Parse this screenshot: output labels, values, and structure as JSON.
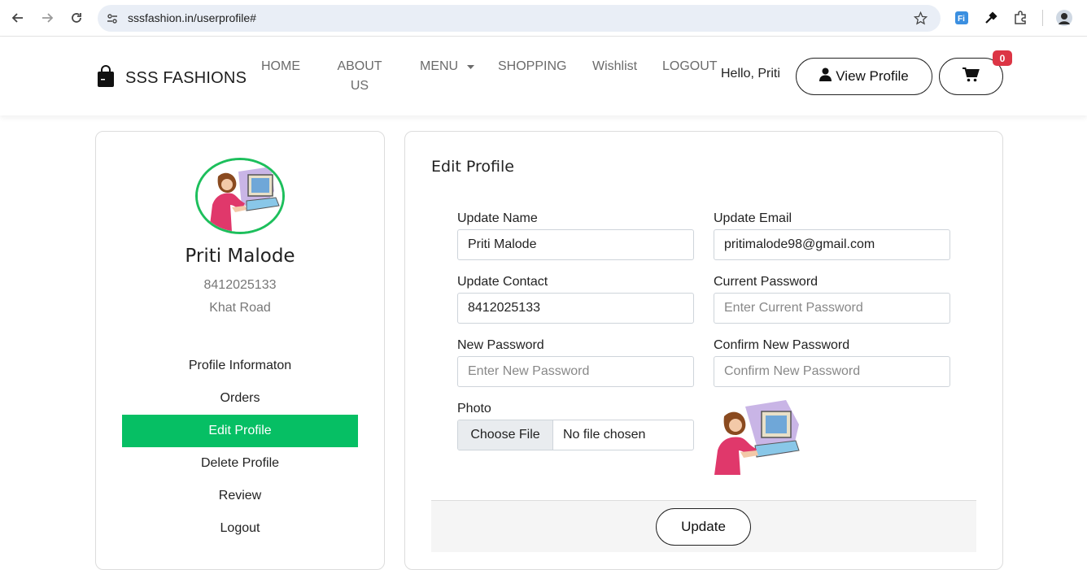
{
  "browser": {
    "url": "sssfashion.in/userprofile#"
  },
  "header": {
    "brand": "SSS FASHIONS",
    "nav": [
      {
        "label": "HOME"
      },
      {
        "label": "ABOUT US"
      },
      {
        "label": "MENU"
      },
      {
        "label": "SHOPPING"
      },
      {
        "label": "Wishlist"
      },
      {
        "label": "LOGOUT"
      }
    ],
    "greeting": "Hello, Priti",
    "view_profile_label": "View Profile",
    "cart_count": "0"
  },
  "profile": {
    "name": "Priti Malode",
    "phone": "8412025133",
    "address": "Khat Road",
    "menu": [
      {
        "label": "Profile Informaton",
        "active": false
      },
      {
        "label": "Orders",
        "active": false
      },
      {
        "label": "Edit Profile",
        "active": true
      },
      {
        "label": "Delete Profile",
        "active": false
      },
      {
        "label": "Review",
        "active": false
      },
      {
        "label": "Logout",
        "active": false
      }
    ]
  },
  "edit_form": {
    "title": "Edit Profile",
    "name_label": "Update Name",
    "name_value": "Priti Malode",
    "email_label": "Update Email",
    "email_value": "pritimalode98@gmail.com",
    "contact_label": "Update Contact",
    "contact_value": "8412025133",
    "current_password_label": "Current Password",
    "current_password_placeholder": "Enter Current Password",
    "new_password_label": "New Password",
    "new_password_placeholder": "Enter New Password",
    "confirm_password_label": "Confirm New Password",
    "confirm_password_placeholder": "Confirm New Password",
    "photo_label": "Photo",
    "choose_file_label": "Choose File",
    "file_status": "No file chosen",
    "update_label": "Update"
  },
  "colors": {
    "accent_green": "#06bf64",
    "badge_red": "#dc3545"
  }
}
